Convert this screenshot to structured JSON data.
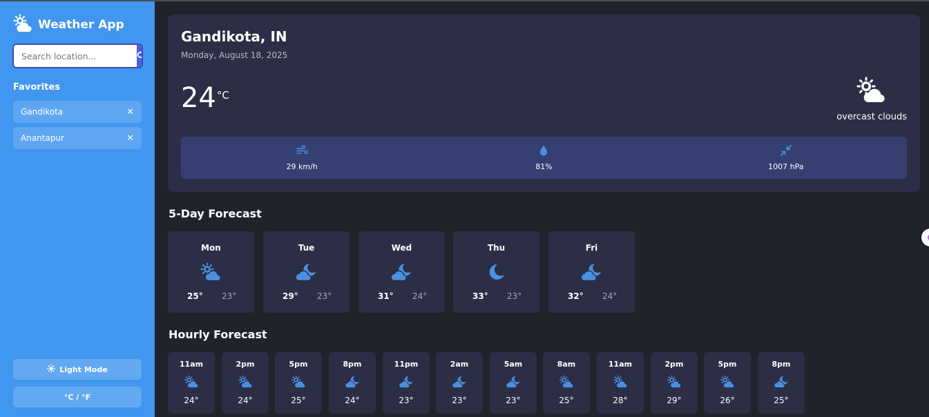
{
  "app": {
    "title": "Weather App",
    "search_placeholder": "Search location..."
  },
  "sidebar": {
    "favorites_title": "Favorites",
    "favorites": [
      {
        "name": "Gandikota"
      },
      {
        "name": "Anantapur"
      }
    ],
    "remove_glyph": "✕",
    "light_mode_label": "Light Mode",
    "unit_toggle_label": "°C / °F"
  },
  "current": {
    "location": "Gandikota, IN",
    "date": "Monday, August 18, 2025",
    "temperature": "24",
    "unit": "°C",
    "condition": "overcast clouds",
    "condition_icon": "cloud-sun-icon",
    "wind": "29 km/h",
    "humidity": "81%",
    "pressure": "1007 hPa"
  },
  "forecast": {
    "title": "5-Day Forecast",
    "days": [
      {
        "day": "Mon",
        "icon": "cloud-sun-icon",
        "high": "25°",
        "low": "23°"
      },
      {
        "day": "Tue",
        "icon": "cloud-moon-icon",
        "high": "29°",
        "low": "23°"
      },
      {
        "day": "Wed",
        "icon": "cloud-moon-icon",
        "high": "31°",
        "low": "24°"
      },
      {
        "day": "Thu",
        "icon": "moon-icon",
        "high": "33°",
        "low": "23°"
      },
      {
        "day": "Fri",
        "icon": "cloud-moon-icon",
        "high": "32°",
        "low": "24°"
      }
    ]
  },
  "hourly": {
    "title": "Hourly Forecast",
    "hours": [
      {
        "time": "11am",
        "icon": "cloud-sun-icon",
        "temp": "24°"
      },
      {
        "time": "2pm",
        "icon": "cloud-sun-icon",
        "temp": "24°"
      },
      {
        "time": "5pm",
        "icon": "cloud-sun-icon",
        "temp": "25°"
      },
      {
        "time": "8pm",
        "icon": "cloud-moon-icon",
        "temp": "24°"
      },
      {
        "time": "11pm",
        "icon": "cloud-moon-icon",
        "temp": "23°"
      },
      {
        "time": "2am",
        "icon": "cloud-moon-icon",
        "temp": "23°"
      },
      {
        "time": "5am",
        "icon": "cloud-moon-icon",
        "temp": "23°"
      },
      {
        "time": "8am",
        "icon": "cloud-sun-icon",
        "temp": "25°"
      },
      {
        "time": "11am",
        "icon": "cloud-sun-icon",
        "temp": "28°"
      },
      {
        "time": "2pm",
        "icon": "cloud-sun-icon",
        "temp": "29°"
      },
      {
        "time": "5pm",
        "icon": "cloud-sun-icon",
        "temp": "26°"
      },
      {
        "time": "8pm",
        "icon": "cloud-moon-icon",
        "temp": "25°"
      }
    ]
  },
  "colors": {
    "sidebar": "#4196f0",
    "background": "#202329",
    "card": "#2c2e45",
    "stats_bar": "#353f72",
    "icon_accent": "#4a90e2"
  }
}
